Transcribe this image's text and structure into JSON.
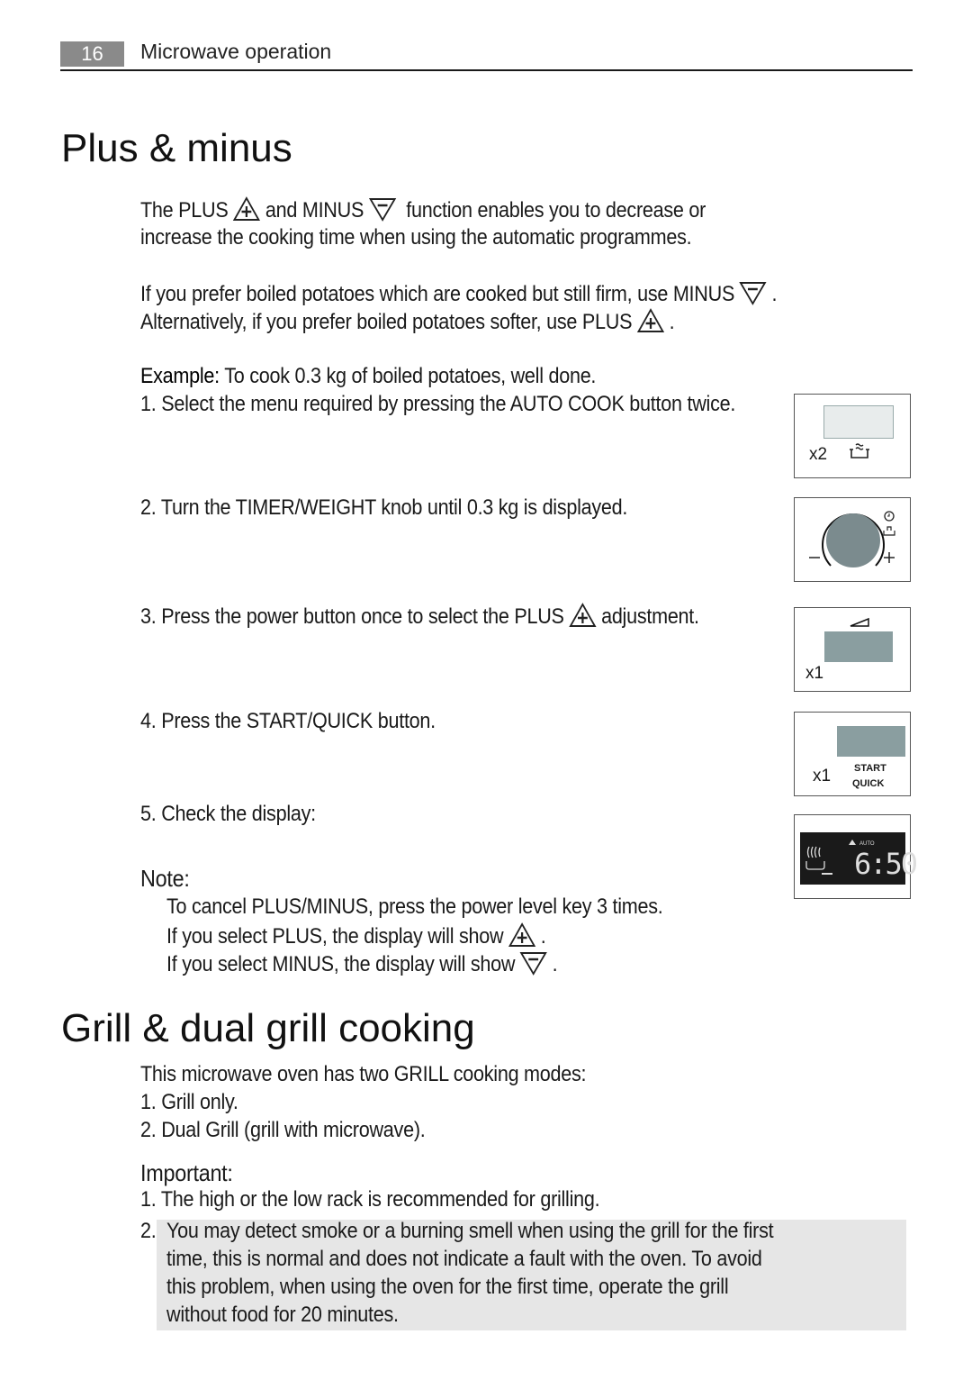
{
  "header": {
    "page_number": "16",
    "section": "Microwave operation"
  },
  "plus_minus": {
    "title": "Plus & minus",
    "intro_1a": "The PLUS",
    "intro_1b": "and MINUS",
    "intro_1c": "function enables you to decrease or",
    "intro_2": "increase the cooking time when using the automatic programmes.",
    "pref_1": "If you prefer boiled potatoes which are cooked but still firm, use MINUS",
    "pref_2": "Alternatively, if you prefer boiled potatoes softer, use PLUS",
    "example_label": "Example:",
    "example_text": "To cook 0.3 kg of boiled potatoes, well done.",
    "steps": [
      {
        "num": "1.",
        "text": "Select the menu required by pressing the AUTO COOK button twice."
      },
      {
        "num": "2.",
        "text": "Turn the TIMER/WEIGHT knob until 0.3 kg is displayed."
      },
      {
        "num": "3.",
        "text_a": "Press the power button once to select the PLUS",
        "text_b": "adjustment."
      },
      {
        "num": "4.",
        "text": "Press the START/QUICK button."
      },
      {
        "num": "5.",
        "text": "Check the display:"
      }
    ],
    "panels": {
      "p1_count": "x2",
      "p3_count": "x1",
      "p4_count": "x1",
      "p4_start": "START",
      "p4_quick": "QUICK",
      "p5_auto": "AUTO",
      "p5_time": "6:50"
    },
    "note_label": "Note:",
    "note_1": "To cancel PLUS/MINUS, press the power level key 3 times.",
    "note_2": "If you select PLUS, the display will show",
    "note_3": "If you select MINUS, the display will show"
  },
  "grill": {
    "title": "Grill & dual grill cooking",
    "intro": "This microwave oven has two GRILL cooking modes:",
    "modes": [
      "1. Grill only.",
      "2. Dual Grill (grill with microwave)."
    ],
    "important_label": "Important:",
    "important_1": "1. The high or the low rack is recommended for grilling.",
    "important_2_num": "2.",
    "important_2_lines": [
      "You may detect smoke or a burning smell when using the grill for the first",
      "time, this is normal and does not indicate a fault with the oven. To avoid",
      "this problem, when using the oven for the first time, operate the grill",
      "without food for 20 minutes."
    ]
  },
  "colors": {
    "panel_display": "#8a9ea0",
    "lcd_bg": "#1a1a1a",
    "highlight_bg": "#e6e6e6"
  }
}
